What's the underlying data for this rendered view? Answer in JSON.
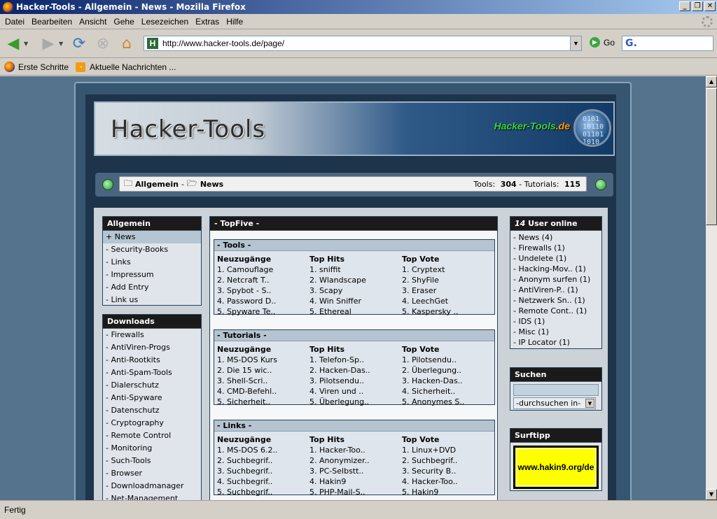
{
  "window": {
    "title": "Hacker-Tools - Allgemein - News - Mozilla Firefox"
  },
  "menu": [
    "Datei",
    "Bearbeiten",
    "Ansicht",
    "Gehe",
    "Lesezeichen",
    "Extras",
    "Hilfe"
  ],
  "nav": {
    "url": "http://www.hacker-tools.de/page/",
    "go_label": "Go",
    "search_placeholder": "G."
  },
  "bookmarks": [
    "Erste Schritte",
    "Aktuelle Nachrichten ..."
  ],
  "status": "Fertig",
  "site": {
    "banner_title": "Hacker-Tools",
    "banner_domain_main": "Hacker-Tools",
    "banner_domain_tld": ".de",
    "globe_digits": [
      "0101",
      "10110",
      "01101",
      "1010"
    ],
    "breadcrumb": {
      "root": "Allgemein",
      "sep": "-",
      "current": "News",
      "tools_label": "Tools:",
      "tools_count": "304",
      "dash": "-",
      "tutorials_label": "Tutorials:",
      "tutorials_count": "115"
    }
  },
  "left": {
    "allgemein": {
      "title": "Allgemein",
      "items": [
        "+ News",
        "- Security-Books",
        "- Links",
        "- Impressum",
        "- Add Entry",
        "- Link us"
      ]
    },
    "downloads": {
      "title": "Downloads",
      "items": [
        "- Firewalls",
        "- AntiViren-Progs",
        "- Anti-Rootkits",
        "- Anti-Spam-Tools",
        "- Dialerschutz",
        "- Anti-Spyware",
        "- Datenschutz",
        "- Cryptography",
        "- Remote Control",
        "- Monitoring",
        "- Such-Tools",
        "- Browser",
        "- Downloadmanager",
        "- Net-Management"
      ]
    }
  },
  "center": {
    "title": "- TopFive -",
    "sections": [
      {
        "title": "- Tools -",
        "cols": [
          {
            "head": "Neuzugänge",
            "items": [
              "1. Camouflage",
              "2. Netcraft T..",
              "3. Spybot - S..",
              "4. Password D..",
              "5. Spyware Te.."
            ]
          },
          {
            "head": "Top Hits",
            "items": [
              "1. sniffit",
              "2. Wlandscape",
              "3. Scapy",
              "4. Win Sniffer",
              "5. Ethereal"
            ]
          },
          {
            "head": "Top Vote",
            "items": [
              "1. Cryptext",
              "2. ShyFile",
              "3. Eraser",
              "4. LeechGet",
              "5. Kaspersky .."
            ]
          }
        ]
      },
      {
        "title": "- Tutorials -",
        "cols": [
          {
            "head": "Neuzugänge",
            "items": [
              "1. MS-DOS Kurs",
              "2. Die 15 wic..",
              "3. Shell-Scri..",
              "4. CMD-Befehl..",
              "5. Sicherheit.."
            ]
          },
          {
            "head": "Top Hits",
            "items": [
              "1. Telefon-Sp..",
              "2. Hacken-Das..",
              "3. Pilotsendu..",
              "4. Viren und ..",
              "5. Überlegung.."
            ]
          },
          {
            "head": "Top Vote",
            "items": [
              "1. Pilotsendu..",
              "2. Überlegung..",
              "3. Hacken-Das..",
              "4. Sicherheit..",
              "5. Anonymes S.."
            ]
          }
        ]
      },
      {
        "title": "- Links -",
        "cols": [
          {
            "head": "Neuzugänge",
            "items": [
              "1. MS-DOS 6.2..",
              "2. Suchbegrif..",
              "3. Suchbegrif..",
              "4. Suchbegrif..",
              "5. Suchbegrif.."
            ]
          },
          {
            "head": "Top Hits",
            "items": [
              "1. Hacker-Too..",
              "2. Anonymizer..",
              "3. PC-Selbstt..",
              "4. Hakin9",
              "5. PHP-Mail-S.."
            ]
          },
          {
            "head": "Top Vote",
            "items": [
              "1. Linux+DVD",
              "2. Suchbegrif..",
              "3. Security B..",
              "4. Hacker-Too..",
              "5. Hakin9"
            ]
          }
        ]
      }
    ]
  },
  "right": {
    "online": {
      "count": "14",
      "title": "User online",
      "items": [
        "- News (4)",
        "- Firewalls (1)",
        "- Undelete (1)",
        "- Hacking-Mov.. (1)",
        "- Anonym surfen (1)",
        "- AntiViren-P.. (1)",
        "- Netzwerk Sn.. (1)",
        "- Remote Cont.. (1)",
        "- IDS (1)",
        "- Misc (1)",
        "- IP Locator (1)"
      ]
    },
    "suchen": {
      "title": "Suchen",
      "select": "-durchsuchen in-"
    },
    "surftipp": {
      "title": "Surftipp",
      "ad": "www.hakin9.org/de"
    }
  }
}
